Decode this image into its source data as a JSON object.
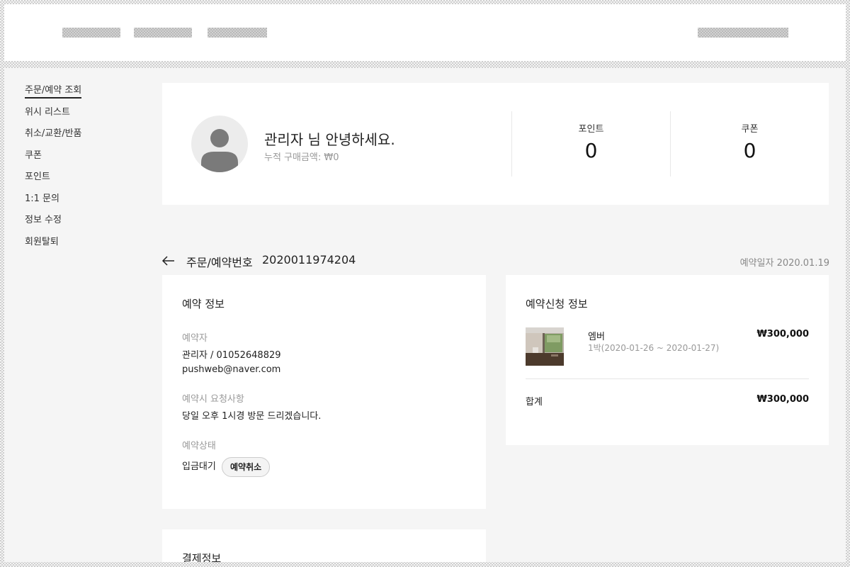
{
  "sidebar": {
    "items": [
      {
        "label": "주문/예약 조회"
      },
      {
        "label": "위시 리스트"
      },
      {
        "label": "취소/교환/반품"
      },
      {
        "label": "쿠폰"
      },
      {
        "label": "포인트"
      },
      {
        "label": "1:1 문의"
      },
      {
        "label": "정보 수정"
      },
      {
        "label": "회원탈퇴"
      }
    ]
  },
  "profile": {
    "greeting": "관리자 님 안녕하세요.",
    "total_purchase": "누적 구매금액: ₩0",
    "points_label": "포인트",
    "points_value": "0",
    "coupons_label": "쿠폰",
    "coupons_value": "0"
  },
  "order": {
    "label": "주문/예약번호",
    "number": "2020011974204",
    "date": "예약일자 2020.01.19"
  },
  "booking": {
    "title": "예약 정보",
    "booker_label": "예약자",
    "booker_value": "관리자 / 01052648829",
    "booker_email": "pushweb@naver.com",
    "request_label": "예약시 요청사항",
    "request_value": "당일 오후 1시경 방문 드리겠습니다.",
    "status_label": "예약상태",
    "status_value": "입금대기",
    "cancel_label": "예약취소"
  },
  "request": {
    "title": "예약신청 정보",
    "room_name": "엠버",
    "room_dates": "1박(2020-01-26 ~ 2020-01-27)",
    "room_price": "₩300,000",
    "total_label": "합계",
    "total_value": "₩300,000"
  },
  "payment": {
    "title": "결제정보"
  }
}
